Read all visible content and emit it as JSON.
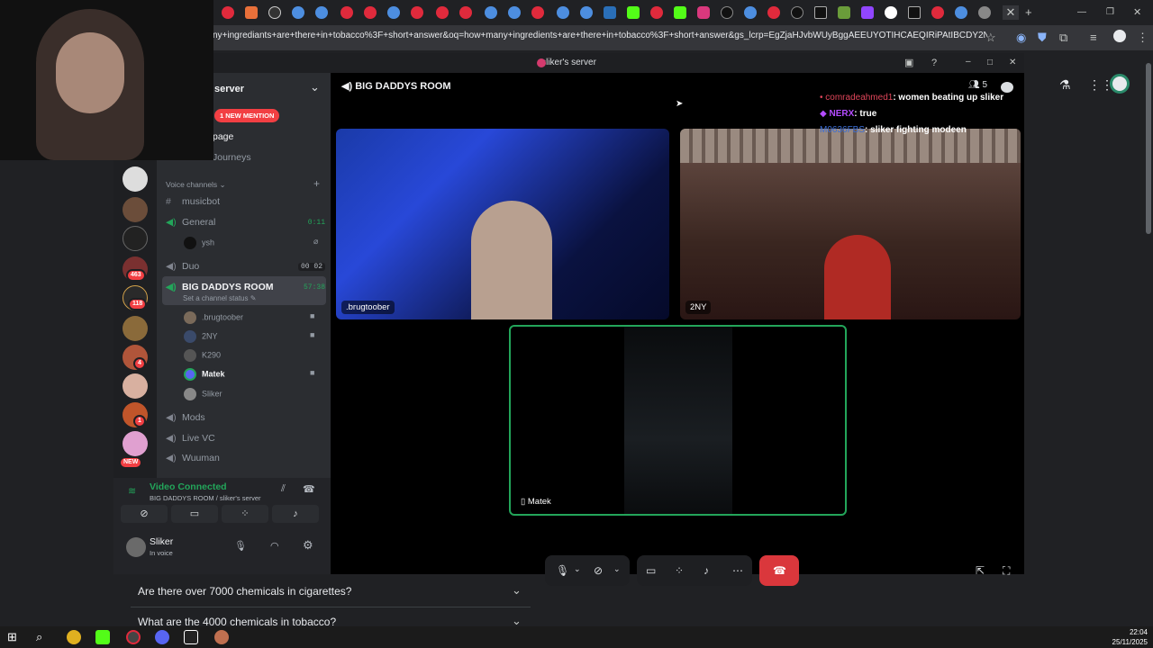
{
  "browser": {
    "url": "ny+ingrediants+are+there+in+tobacco%3F+short+answer&oq=how+many+ingredients+are+there+in+tobacco%3F+short+answer&gs_lcrp=EgZjaHJvbWUyBggAEEUYOTIHCAEQIRiPAtIBCDY2NDdqMGo3..."
  },
  "background_page": {
    "faq_1": "Are there over 7000 chemicals in cigarettes?",
    "faq_2": "What are the 4000 chemicals in tobacco?"
  },
  "discord": {
    "window_title": "sliker's server",
    "server_name": "server",
    "mention_pill": "1 NEW MENTION",
    "channel_page": "page",
    "channel_journeys": "Journeys",
    "voice_category": "Voice channels",
    "channels": {
      "musicbot": "musicbot",
      "general": "General",
      "general_timer": "0:11",
      "general_user": "ysh",
      "duo": "Duo",
      "duo_timer": "00 02",
      "bigdaddys": "BIG DADDYS ROOM",
      "bigdaddys_timer": "57:38",
      "channel_status": "Set a channel status",
      "mods": "Mods",
      "live_vc": "Live VC",
      "wuuman": "Wuuman"
    },
    "room_users": [
      ".brugtoober",
      "2NY",
      "K290",
      "Matek",
      "Sliker"
    ],
    "guild_badges": [
      "463",
      "118",
      "4",
      "1",
      "NEW"
    ],
    "voice_panel": {
      "status": "Video Connected",
      "location": "BIG DADDYS ROOM / sliker's server"
    },
    "user_panel": {
      "name": "Sliker",
      "status": "In voice"
    },
    "call": {
      "header": "BIG DADDYS ROOM",
      "participant_count": "5",
      "tiles": [
        ".brugtoober",
        "2NY",
        "Matek"
      ]
    }
  },
  "stream_chat": [
    {
      "user": "comradeahmed1",
      "msg": ": women beating up sliker",
      "color": "#e0465a"
    },
    {
      "user": "NERX",
      "msg": ": true",
      "color": "#b44cff"
    },
    {
      "user": "M0636FBS",
      "msg": ": sliker fighting modeen",
      "color": "#3b6ed6"
    }
  ],
  "taskbar": {
    "time": "22:04",
    "date": "25/11/2025"
  }
}
